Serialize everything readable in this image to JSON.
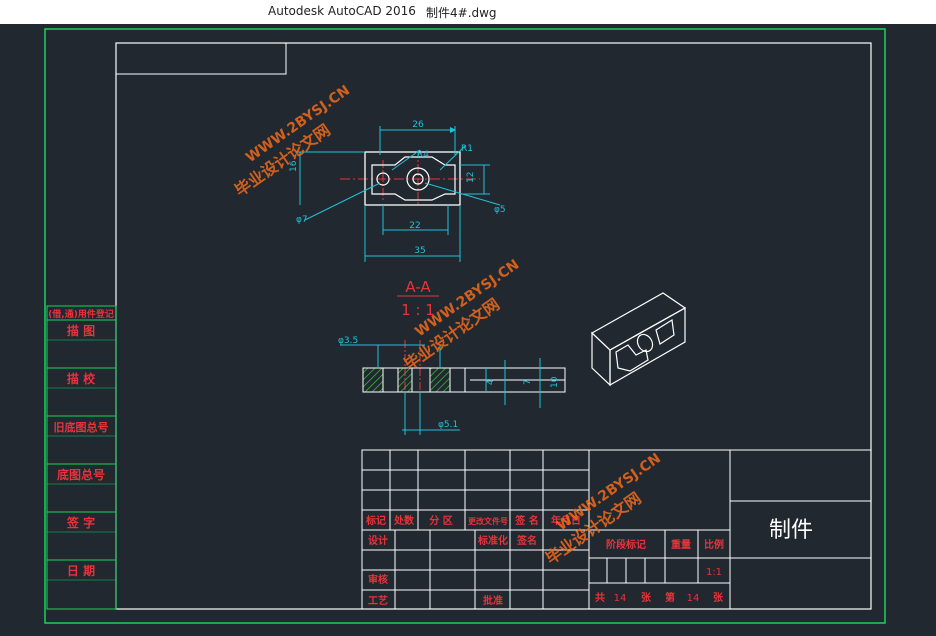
{
  "window": {
    "app_title": "Autodesk AutoCAD 2016",
    "file_name": "制件4#.dwg"
  },
  "colors": {
    "background": "#212830",
    "border": "#19d35a",
    "frame": "#ffffff",
    "dimension": "#1fc2d8",
    "center_line": "#e8333a",
    "table_label": "#e8333a",
    "watermark": "#f06a1c",
    "hatch": "#3ad13a"
  },
  "drawing": {
    "section_label": "A-A",
    "section_scale": "1 : 1",
    "top_view_dims": {
      "width_top": "26",
      "width_inner": "22",
      "width_bottom": "35",
      "radius_inner": "R4",
      "radius_outer": "R1",
      "height_left": "16",
      "height_right": "12",
      "hole_left": "φ7",
      "hole_right": "φ5"
    },
    "section_dims": {
      "bore_top": "φ3.5",
      "bore_bottom": "φ5.1",
      "height_inner": "4",
      "height_mid": "7",
      "height_outer": "10"
    }
  },
  "left_column": {
    "header": "(借,通)用件登记",
    "items": [
      "描 图",
      "描 校",
      "旧底图总号",
      "底图总号",
      "签 字",
      "日 期"
    ]
  },
  "title_block": {
    "part_name": "制件",
    "row_labels": [
      "标记",
      "处数",
      "分 区",
      "更改文件号",
      "签 名",
      "年月日"
    ],
    "design_label": "设计",
    "std_label": "标准化",
    "sign_label": "签名",
    "review_label": "审核",
    "craft_label": "工艺",
    "approve_label": "批准",
    "stage_label": "阶段标记",
    "weight_label": "重量",
    "scale_label": "比例",
    "scale_value": "1:1",
    "sheet_total_label": "共",
    "sheet_total": "14",
    "sheet_unit": "张",
    "sheet_no_label": "第",
    "sheet_no": "14",
    "sheet_unit2": "张"
  },
  "watermarks": [
    {
      "text": "毕业设计论文网"
    },
    {
      "text": "WWW.2BYSJ.CN"
    }
  ]
}
